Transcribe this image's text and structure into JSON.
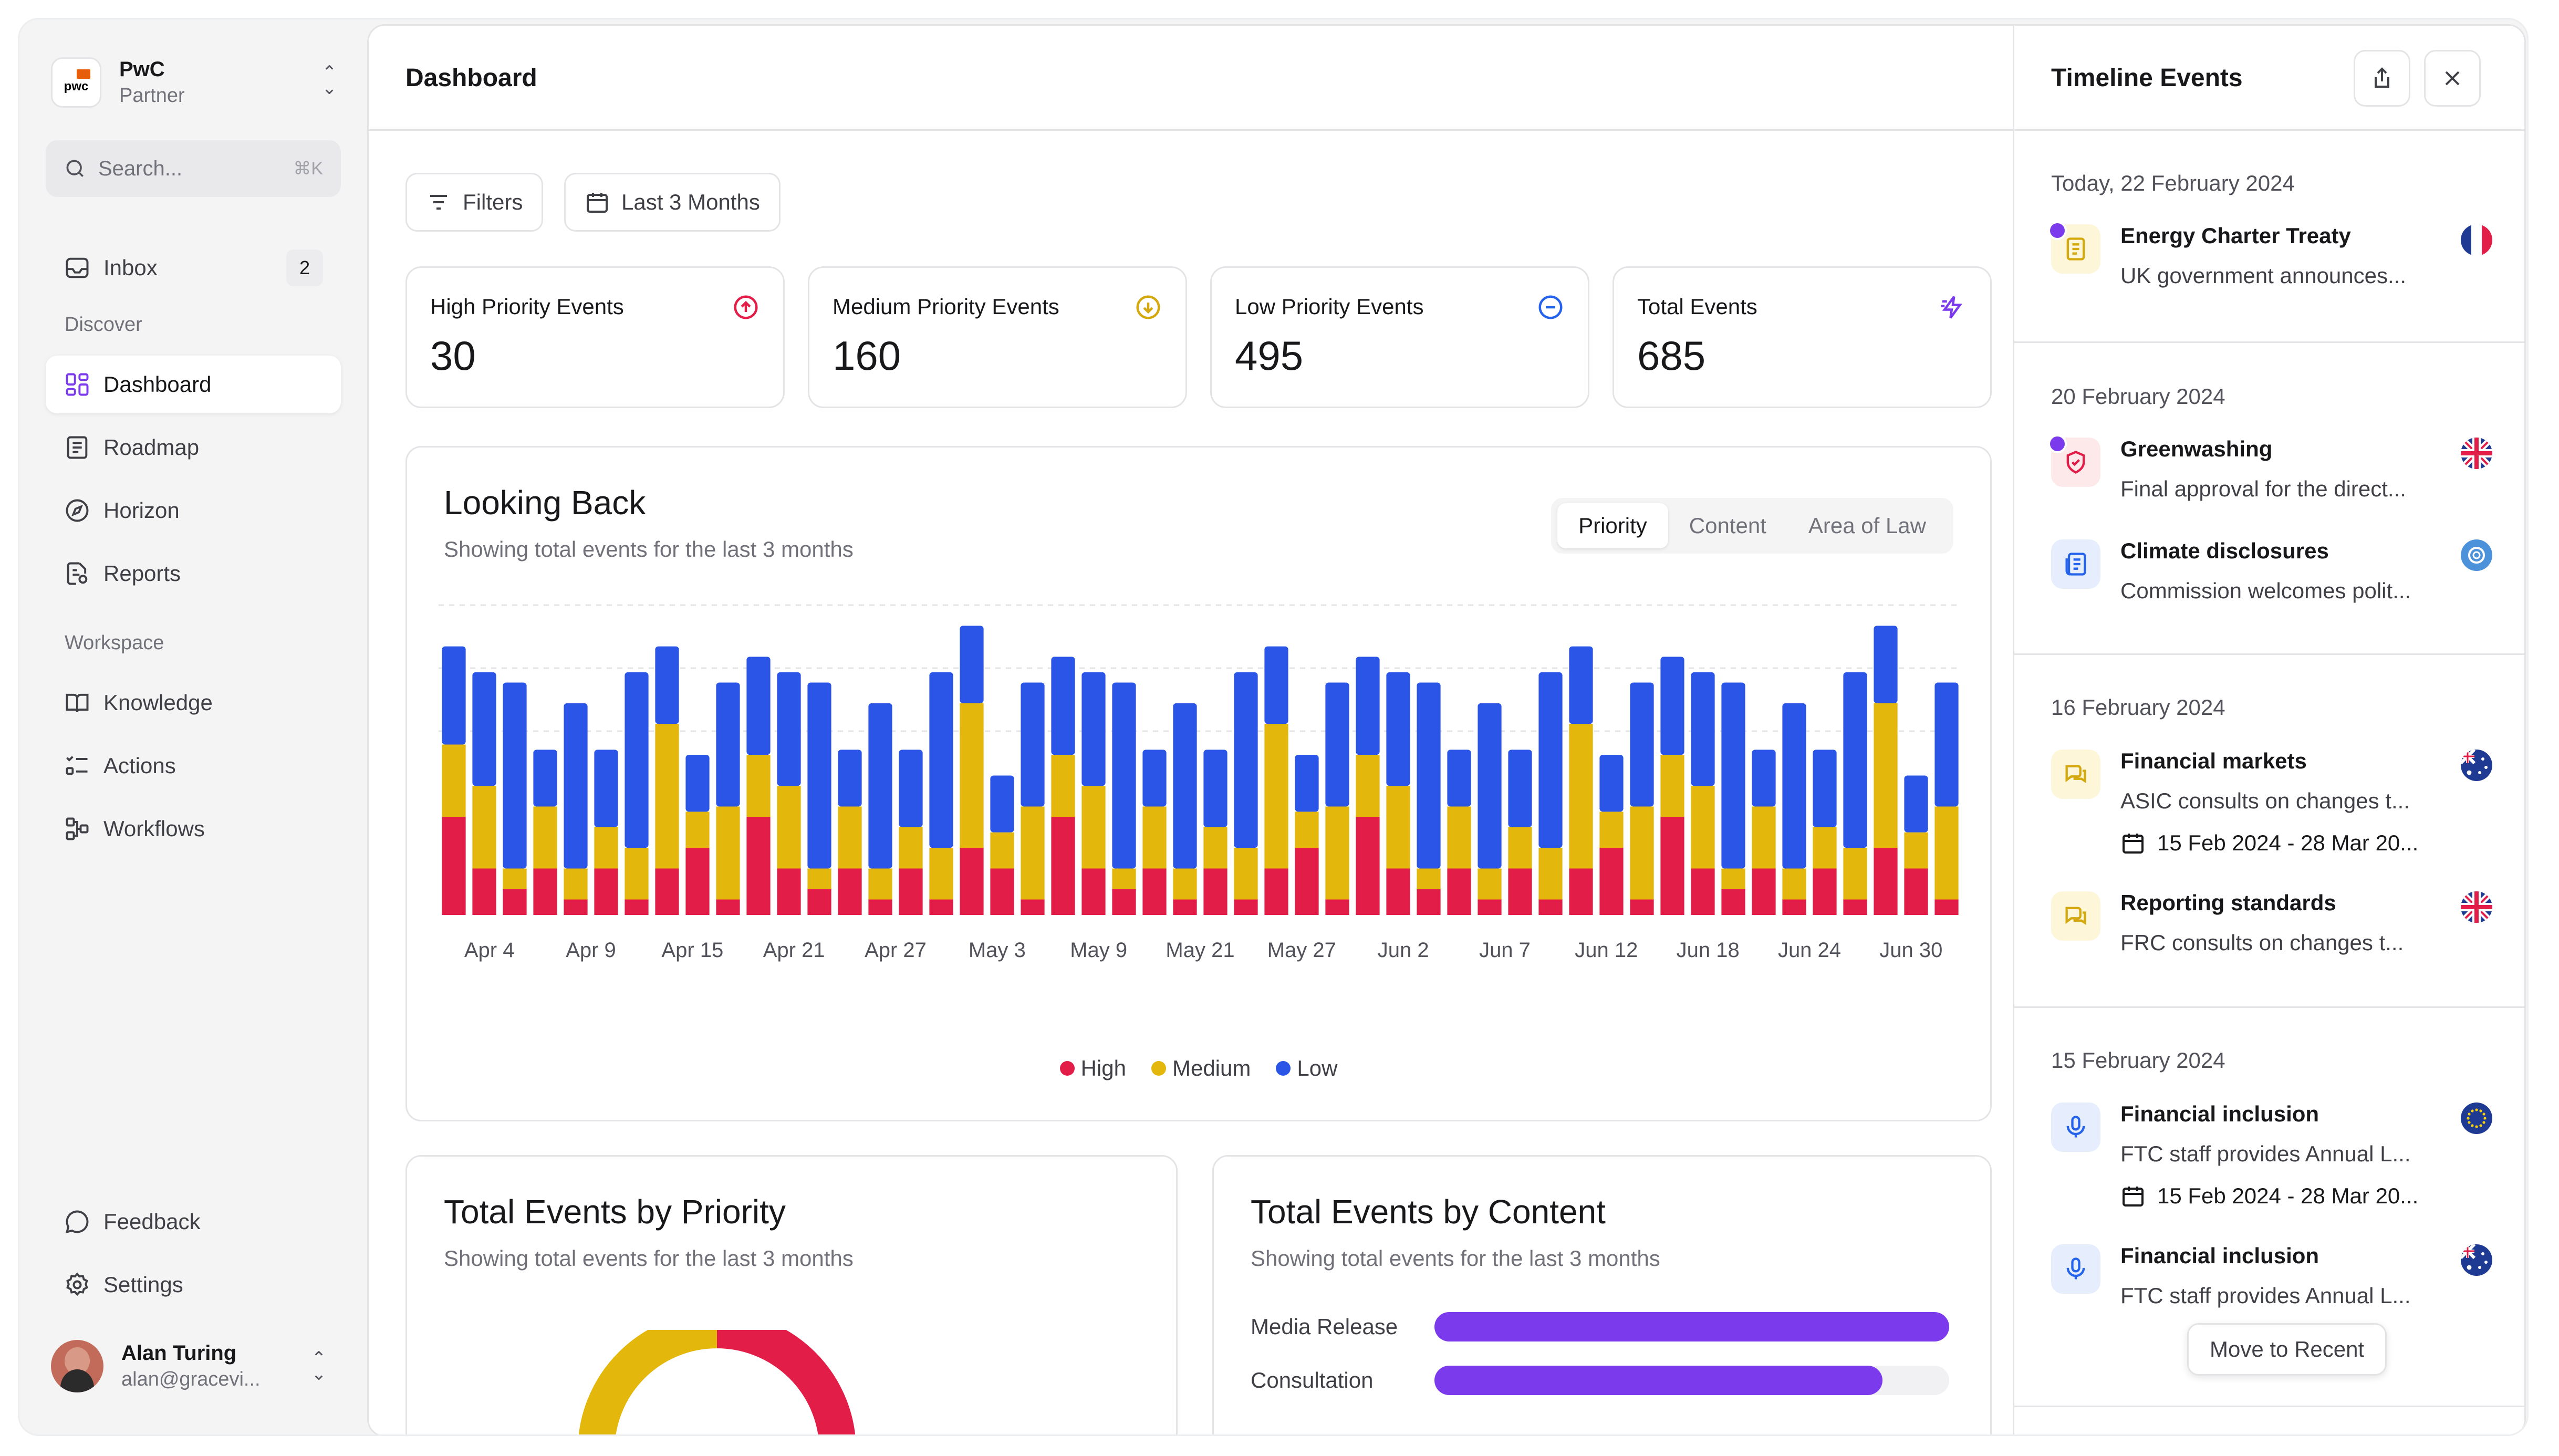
{
  "org": {
    "name": "PwC",
    "role": "Partner",
    "logo_text": "pwc"
  },
  "search": {
    "placeholder": "Search...",
    "shortcut": "⌘K"
  },
  "nav": {
    "inbox": {
      "label": "Inbox",
      "count": "2"
    },
    "discover_label": "Discover",
    "discover": [
      {
        "label": "Dashboard",
        "icon": "dashboard-icon"
      },
      {
        "label": "Roadmap",
        "icon": "roadmap-icon"
      },
      {
        "label": "Horizon",
        "icon": "compass-icon"
      },
      {
        "label": "Reports",
        "icon": "reports-icon"
      }
    ],
    "workspace_label": "Workspace",
    "workspace": [
      {
        "label": "Knowledge",
        "icon": "book-icon"
      },
      {
        "label": "Actions",
        "icon": "checklist-icon"
      },
      {
        "label": "Workflows",
        "icon": "workflow-icon"
      }
    ],
    "feedback": "Feedback",
    "settings": "Settings"
  },
  "user": {
    "name": "Alan Turing",
    "email": "alan@gracevi..."
  },
  "header": {
    "title": "Dashboard",
    "filters": "Filters",
    "range": "Last 3 Months"
  },
  "stats": [
    {
      "label": "High Priority Events",
      "value": "30",
      "icon": "arrow-up-circle-icon",
      "color": "#e11d48"
    },
    {
      "label": "Medium Priority Events",
      "value": "160",
      "icon": "arrow-down-circle-icon",
      "color": "#d4a80f"
    },
    {
      "label": "Low Priority Events",
      "value": "495",
      "icon": "minus-circle-icon",
      "color": "#2563eb"
    },
    {
      "label": "Total Events",
      "value": "685",
      "icon": "lightning-icon",
      "color": "#7c3aed"
    }
  ],
  "looking_back": {
    "title": "Looking Back",
    "subtitle": "Showing total events for the last 3 months",
    "tabs": [
      "Priority",
      "Content",
      "Area of Law"
    ],
    "active_tab": "Priority"
  },
  "chart_data": {
    "type": "bar",
    "stacked": true,
    "x_tick_labels": [
      "Apr 4",
      "Apr 9",
      "Apr 15",
      "Apr 21",
      "Apr 27",
      "May 3",
      "May 9",
      "May 21",
      "May 27",
      "Jun 2",
      "Jun 7",
      "Jun 12",
      "Jun 18",
      "Jun 24",
      "Jun 30"
    ],
    "grid": true,
    "legend_position": "bottom",
    "series": [
      {
        "name": "High",
        "color": "#e11d48",
        "values": [
          19,
          9,
          5,
          9,
          3,
          9,
          3,
          9,
          13,
          3,
          19,
          9,
          5,
          9,
          3,
          9,
          3,
          13,
          9,
          3,
          19,
          9,
          5,
          9,
          3,
          9,
          3,
          9,
          13,
          3,
          19,
          9,
          5,
          9,
          3,
          9,
          3,
          9,
          13,
          3,
          19,
          9,
          5,
          9,
          3,
          9,
          3,
          13,
          9,
          3
        ]
      },
      {
        "name": "Medium",
        "color": "#e3b70b",
        "values": [
          14,
          16,
          4,
          12,
          6,
          8,
          10,
          28,
          7,
          18,
          12,
          16,
          4,
          12,
          6,
          8,
          10,
          28,
          7,
          18,
          12,
          16,
          4,
          12,
          6,
          8,
          10,
          28,
          7,
          18,
          12,
          16,
          4,
          12,
          6,
          8,
          10,
          28,
          7,
          18,
          12,
          16,
          4,
          12,
          6,
          8,
          10,
          28,
          7,
          18
        ]
      },
      {
        "name": "Low",
        "color": "#2b55e6",
        "values": [
          19,
          22,
          36,
          11,
          32,
          15,
          34,
          15,
          11,
          24,
          19,
          22,
          36,
          11,
          32,
          15,
          34,
          15,
          11,
          24,
          19,
          22,
          36,
          11,
          32,
          15,
          34,
          15,
          11,
          24,
          19,
          22,
          36,
          11,
          32,
          15,
          34,
          15,
          11,
          24,
          19,
          22,
          36,
          11,
          32,
          15,
          34,
          15,
          11,
          24
        ]
      }
    ],
    "ylim": [
      0,
      60
    ]
  },
  "by_priority": {
    "title": "Total Events by Priority",
    "subtitle": "Showing total events for the last 3 months"
  },
  "by_content": {
    "title": "Total Events by Content",
    "subtitle": "Showing total events for the last 3 months",
    "rows": [
      {
        "label": "Media Release",
        "value": 1.0
      },
      {
        "label": "Consultation",
        "value": 0.87
      }
    ]
  },
  "timeline": {
    "title": "Timeline Events",
    "move_to_recent": "Move to Recent",
    "days": [
      {
        "label": "Today, 22 February 2024",
        "events": [
          {
            "title": "Energy Charter Treaty",
            "desc": "UK government announces...",
            "icon": "document-icon",
            "flag": "france-flag-icon",
            "unread": true
          }
        ]
      },
      {
        "label": "20 February 2024",
        "events": [
          {
            "title": "Greenwashing",
            "desc": "Final approval for the direct...",
            "icon": "shield-icon",
            "flag": "uk-flag-icon",
            "unread": true
          },
          {
            "title": "Climate disclosures",
            "desc": "Commission welcomes polit...",
            "icon": "newspaper-icon",
            "flag": "un-flag-icon",
            "unread": false
          }
        ]
      },
      {
        "label": "16 February 2024",
        "events": [
          {
            "title": "Financial markets",
            "desc": "ASIC consults on changes t...",
            "date": "15 Feb 2024 - 28 Mar 20...",
            "icon": "chat-icon",
            "flag": "australia-flag-icon"
          },
          {
            "title": "Reporting standards",
            "desc": "FRC consults on changes t...",
            "icon": "chat-icon",
            "flag": "uk-flag-icon"
          }
        ]
      },
      {
        "label": "15 February 2024",
        "events": [
          {
            "title": "Financial inclusion",
            "desc": "FTC staff provides Annual L...",
            "date": "15 Feb 2024 - 28 Mar 20...",
            "icon": "microphone-icon",
            "flag": "eu-flag-icon"
          },
          {
            "title": "Financial inclusion",
            "desc": "FTC staff provides Annual L...",
            "icon": "microphone-icon",
            "flag": "australia-flag-icon"
          }
        ]
      }
    ]
  }
}
